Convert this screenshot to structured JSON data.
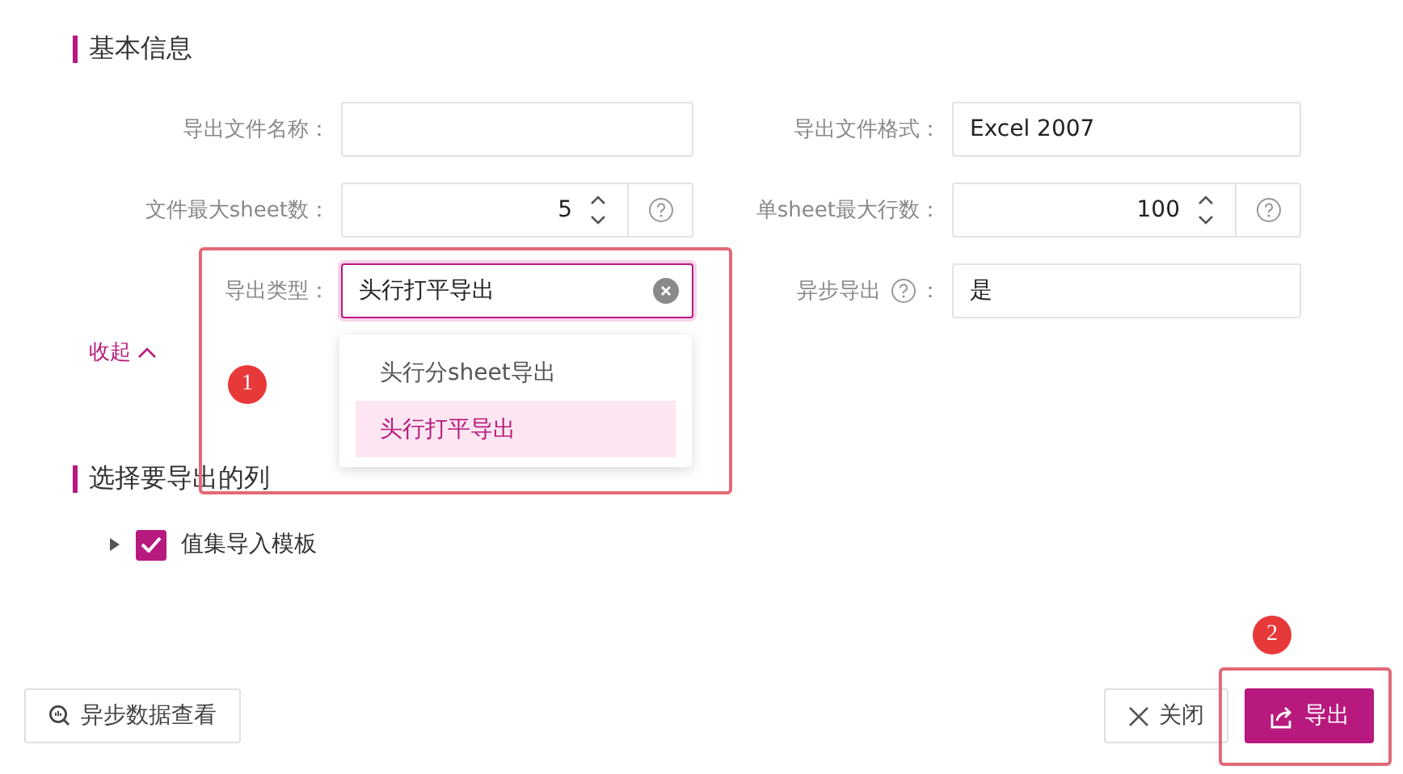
{
  "basic_info": {
    "title": "基本信息",
    "fields": [
      {
        "kind": "text",
        "label": "导出文件名称："
      },
      {
        "kind": "text",
        "label": "导出文件格式：",
        "value": "Excel 2007"
      },
      {
        "kind": "number",
        "label": "文件最大sheet数：",
        "value": "5"
      },
      {
        "kind": "number",
        "label": "单sheet最大行数：",
        "value": "100"
      },
      {
        "kind": "select",
        "label": "导出类型：",
        "value": "头行打平导出",
        "focused": true
      },
      {
        "kind": "text",
        "label": "异步导出",
        "label_help": true,
        "label_colon": "：",
        "value": "是"
      }
    ],
    "dropdown": {
      "options": [
        {
          "label": "头行分sheet导出",
          "selected": false
        },
        {
          "label": "头行打平导出",
          "selected": true
        }
      ]
    },
    "collapse_link": "收起"
  },
  "columns_section": {
    "title": "选择要导出的列",
    "tree": [
      {
        "label": "值集导入模板",
        "checked": true,
        "expanded": false
      }
    ]
  },
  "footer": {
    "left_button": "异步数据查看",
    "close_button": "关闭",
    "export_button": "导出"
  },
  "annotations": [
    {
      "number": "1"
    },
    {
      "number": "2"
    }
  ]
}
